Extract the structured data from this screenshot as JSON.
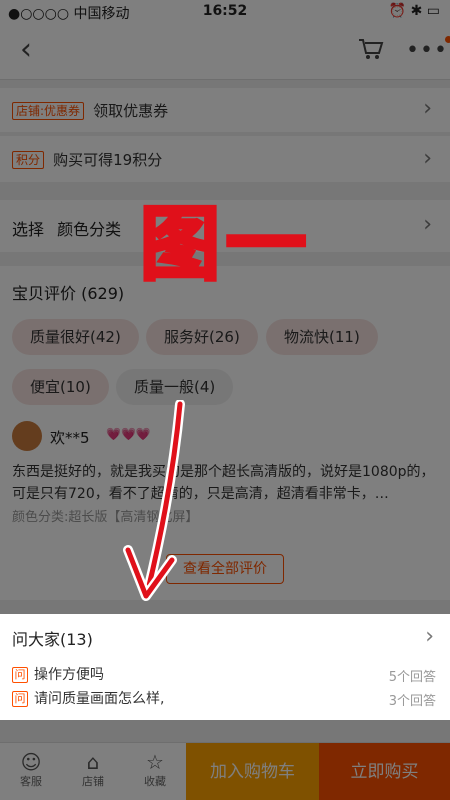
{
  "status": {
    "carrier": "●○○○○ 中国移动",
    "time": "16:52",
    "right": "⏰ ✱ ▭"
  },
  "nav": {
    "back": "‹",
    "more": "•••"
  },
  "coupon": {
    "tag": "店铺:优惠券",
    "text": "领取优惠券"
  },
  "points": {
    "tag": "积分",
    "text": "购买可得19积分"
  },
  "select": {
    "label": "选择",
    "value": "颜色分类"
  },
  "reviews": {
    "title": "宝贝评价 (629)",
    "chips": [
      "质量很好(42)",
      "服务好(26)",
      "物流快(11)",
      "便宜(10)",
      "质量一般(4)"
    ],
    "user": "欢**5",
    "hearts": "💗💗💗",
    "text": "东西是挺好的，就是我买的是那个超长高清版的，说好是1080p的，可是只有720，看不了超清的，只是高清，超清看非常卡，…",
    "sku": "颜色分类:超长版【高清钢化屏】",
    "view_all": "查看全部评价"
  },
  "qa": {
    "title": "问大家(13)",
    "ask_icon": "问",
    "items": [
      {
        "q": "操作方便吗",
        "count": "5个回答"
      },
      {
        "q": "请问质量画面怎么样,",
        "count": "3个回答"
      }
    ]
  },
  "bottom": {
    "service": "客服",
    "shop": "店铺",
    "favorite": "收藏",
    "add_cart": "加入购物车",
    "buy_now": "立即购买"
  },
  "annotation": {
    "text": "图一"
  },
  "colors": {
    "accent": "#ff5000",
    "orange": "#ffa200",
    "annotation": "#e0101a"
  }
}
